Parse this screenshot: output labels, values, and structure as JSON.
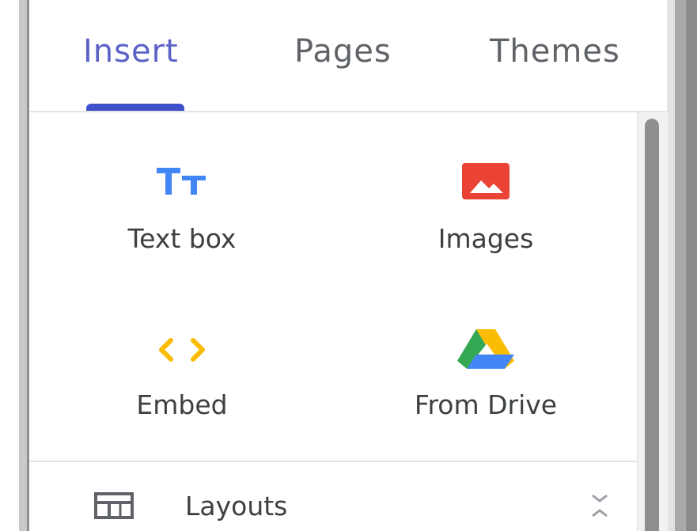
{
  "tabs": [
    {
      "label": "Insert",
      "active": true
    },
    {
      "label": "Pages",
      "active": false
    },
    {
      "label": "Themes",
      "active": false
    }
  ],
  "insert_items": [
    {
      "label": "Text box",
      "icon": "text-box-icon"
    },
    {
      "label": "Images",
      "icon": "image-icon"
    },
    {
      "label": "Embed",
      "icon": "embed-code-icon"
    },
    {
      "label": "From Drive",
      "icon": "google-drive-icon"
    }
  ],
  "sections": {
    "layouts": {
      "label": "Layouts",
      "icon": "layouts-icon",
      "toggle_icon": "collapse-icon"
    }
  },
  "colors": {
    "accent": "#3f51c8",
    "active_tab_text": "#5c62c6",
    "text_icon_blue": "#4285f4",
    "image_red": "#ea4335",
    "embed_yellow": "#fbbc04",
    "drive_green": "#34a853"
  }
}
